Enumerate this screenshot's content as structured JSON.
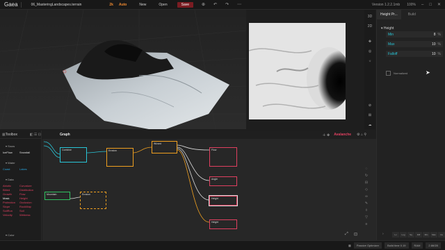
{
  "topbar": {
    "logo": "Gaea",
    "file": "06_MasteringLandscapes.terrain",
    "resolution": "2k",
    "auto": "Auto",
    "new_label": "New",
    "open_label": "Open",
    "save_label": "Save",
    "version": "Version 1.2.2.1mb",
    "zoom": "100%",
    "accent_color": "#f08a30",
    "save_color": "#7a1c22"
  },
  "right_tools": [
    "3D",
    "2D"
  ],
  "props": {
    "tab_active": "Height Pr...",
    "tab_build": "Build",
    "section": "Height",
    "rows": [
      {
        "label": "Min",
        "value": "8",
        "unit": "%"
      },
      {
        "label": "Max",
        "value": "10",
        "unit": "%"
      },
      {
        "label": "Falloff",
        "value": "10",
        "unit": "%"
      }
    ],
    "normalized_label": "Normalized",
    "pp_buttons": [
      "Lv",
      "Log",
      "Sq",
      "Diff",
      "Min",
      "Max",
      "Inv"
    ]
  },
  "toolbox": {
    "title": "Toolbox",
    "sections": [
      {
        "name": "Snow",
        "items": [
          "IceFlow",
          "Snowfall"
        ]
      },
      {
        "name": "Water",
        "items": [
          "Coast",
          "Lakes"
        ]
      },
      {
        "name": "Data",
        "left": [
          "Abiotic",
          "Bitted",
          "Growth",
          "Mask",
          "Protection",
          "Slope",
          "SoilRun",
          "Velocity"
        ],
        "right": [
          "Curvature",
          "Distribution",
          "Flow",
          "Height",
          "Occlusion",
          "RockMap",
          "Soil",
          "Wetness"
        ]
      },
      {
        "name": "Color",
        "items": []
      }
    ]
  },
  "graph": {
    "title": "Graph",
    "avalanche": "Avalanche",
    "nodes": [
      {
        "label": "Combine",
        "color": "#29c6d8"
      },
      {
        "label": "Erosion",
        "color": "#f0a020"
      },
      {
        "label": "Wizard",
        "color": "#f0a020"
      },
      {
        "label": "Flow",
        "color": "#e04060"
      },
      {
        "label": "Angle",
        "color": "#e04060"
      },
      {
        "label": "Height",
        "color": "#e04060"
      },
      {
        "label": "Height",
        "color": "#e04060"
      },
      {
        "label": "Mountain",
        "color": "#30c060"
      },
      {
        "label": "Erosion",
        "color": "#f0a020"
      }
    ]
  },
  "status": {
    "passive": "Passive Optimizer",
    "build": "Build time 0.19",
    "ram": "RAM",
    "size": "2.86GB"
  }
}
